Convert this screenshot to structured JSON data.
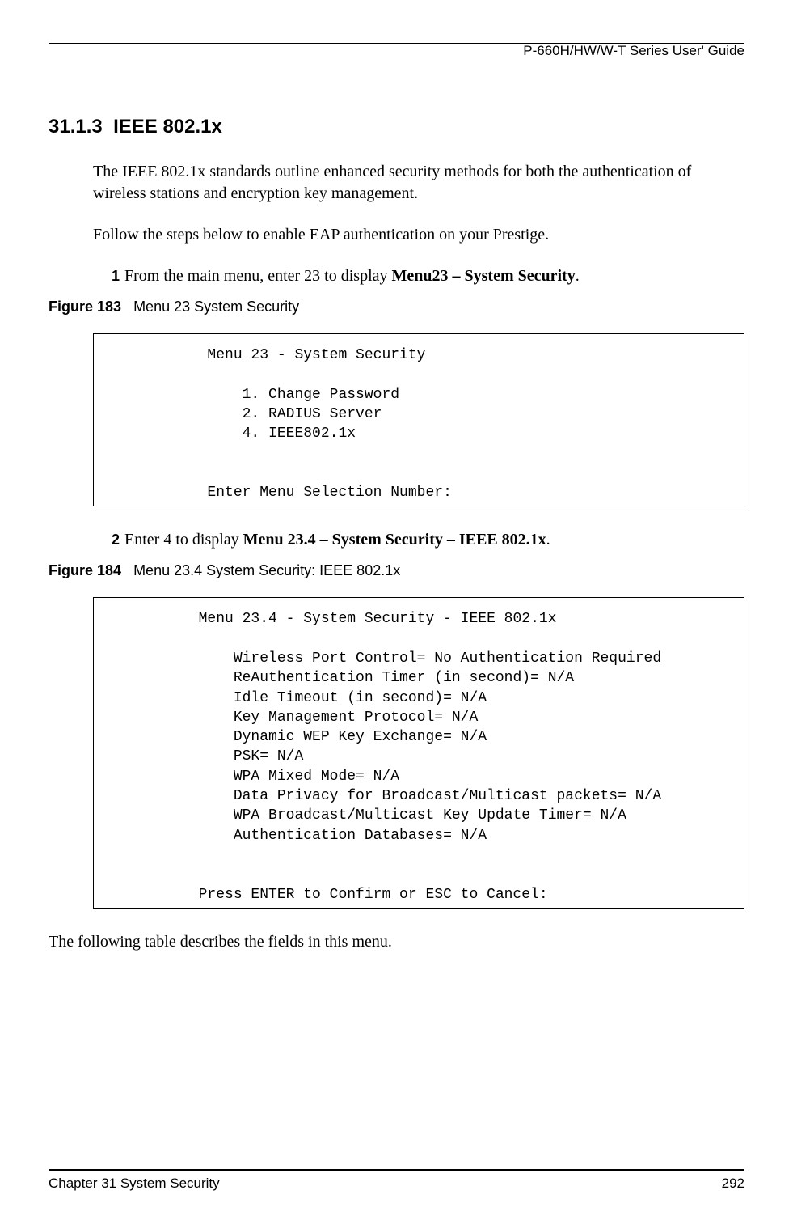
{
  "header": {
    "guide_title": "P-660H/HW/W-T Series User' Guide"
  },
  "section": {
    "number": "31.1.3",
    "title": "IEEE 802.1x"
  },
  "paragraphs": {
    "intro": "The IEEE 802.1x standards outline enhanced security methods for both the authentication of wireless stations and encryption key management.",
    "follow": "Follow the steps below to enable EAP authentication on your Prestige.",
    "closing": "The following table describes the fields in this menu."
  },
  "steps": {
    "s1": {
      "num": "1",
      "text_prefix": "From the main menu, enter 23 to display ",
      "bold": "Menu23 – System Security",
      "suffix": "."
    },
    "s2": {
      "num": "2",
      "text_prefix": "Enter 4 to display ",
      "bold": "Menu 23.4 – System Security – IEEE 802.1x",
      "suffix": "."
    }
  },
  "figures": {
    "f183": {
      "label": "Figure 183",
      "caption": "Menu 23 System Security"
    },
    "f184": {
      "label": "Figure 184",
      "caption": "Menu 23.4 System Security: IEEE 802.1x"
    }
  },
  "menus": {
    "m23": "             Menu 23 - System Security\n\n                 1. Change Password\n                 2. RADIUS Server\n                 4. IEEE802.1x\n\n\n             Enter Menu Selection Number:",
    "m234": "            Menu 23.4 - System Security - IEEE 802.1x\n\n                Wireless Port Control= No Authentication Required\n                ReAuthentication Timer (in second)= N/A\n                Idle Timeout (in second)= N/A\n                Key Management Protocol= N/A\n                Dynamic WEP Key Exchange= N/A\n                PSK= N/A\n                WPA Mixed Mode= N/A\n                Data Privacy for Broadcast/Multicast packets= N/A\n                WPA Broadcast/Multicast Key Update Timer= N/A\n                Authentication Databases= N/A\n\n\n            Press ENTER to Confirm or ESC to Cancel:"
  },
  "footer": {
    "chapter": "Chapter 31 System Security",
    "page": "292"
  }
}
